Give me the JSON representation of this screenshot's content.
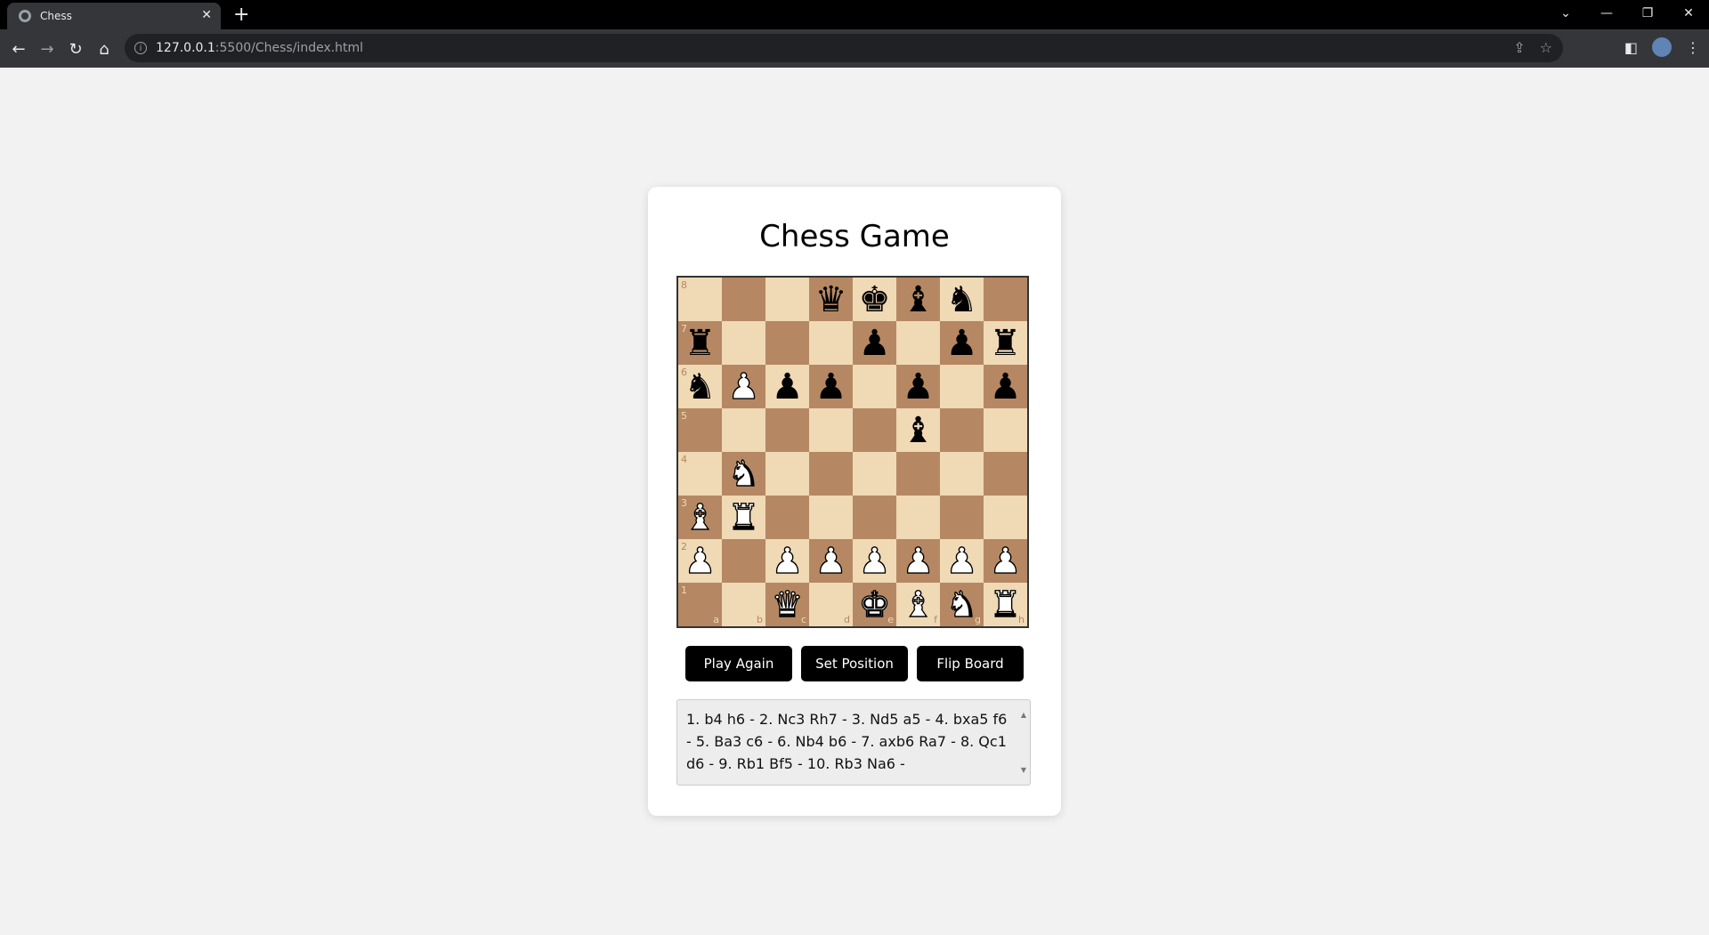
{
  "browser": {
    "tab_title": "Chess",
    "url_host": "127.0.0.1",
    "url_rest": ":5500/Chess/index.html"
  },
  "page": {
    "title": "Chess Game",
    "buttons": {
      "play_again": "Play Again",
      "set_position": "Set Position",
      "flip_board": "Flip Board"
    },
    "moves_text": "1. b4 h6 - 2. Nc3 Rh7 - 3. Nd5 a5 - 4. bxa5 f6 - 5. Ba3 c6 - 6. Nb4 b6 - 7. axb6 Ra7 - 8. Qc1 d6 - 9. Rb1 Bf5 - 10. Rb3 Na6 -"
  },
  "board": {
    "files": [
      "a",
      "b",
      "c",
      "d",
      "e",
      "f",
      "g",
      "h"
    ],
    "ranks": [
      "8",
      "7",
      "6",
      "5",
      "4",
      "3",
      "2",
      "1"
    ],
    "position": [
      [
        "",
        "",
        "",
        "q",
        "k",
        "b",
        "n",
        ""
      ],
      [
        "r",
        "",
        "",
        "",
        "p",
        "",
        "p",
        "r"
      ],
      [
        "n",
        "P",
        "p",
        "p",
        "",
        "p",
        "",
        "p"
      ],
      [
        "",
        "",
        "",
        "",
        "",
        "b",
        "",
        ""
      ],
      [
        "",
        "N",
        "",
        "",
        "",
        "",
        "",
        ""
      ],
      [
        "B",
        "R",
        "",
        "",
        "",
        "",
        "",
        ""
      ],
      [
        "P",
        "",
        "P",
        "P",
        "P",
        "P",
        "P",
        "P"
      ],
      [
        "",
        "",
        "Q",
        "",
        "K",
        "B",
        "N",
        "R"
      ]
    ],
    "colors": {
      "light": "#f0d9b5",
      "dark": "#b58863"
    }
  }
}
